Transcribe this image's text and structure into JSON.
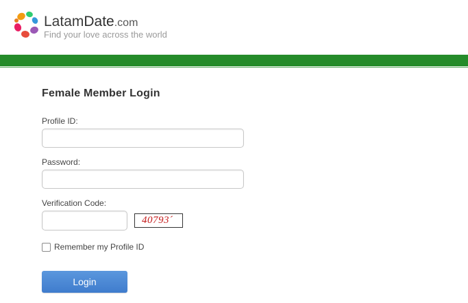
{
  "header": {
    "brand_latam": "Latam",
    "brand_date": "Date",
    "brand_com": ".com",
    "tagline": "Find your love across the world"
  },
  "form": {
    "title": "Female Member Login",
    "profile_label": "Profile ID:",
    "profile_value": "",
    "password_label": "Password:",
    "password_value": "",
    "verify_label": "Verification Code:",
    "verify_value": "",
    "captcha_text": "40793´",
    "remember_label": "Remember my Profile ID",
    "remember_checked": false,
    "login_label": "Login"
  },
  "colors": {
    "green_bar": "#258b2a",
    "login_button": "#4a88d6",
    "captcha_text": "#c41b1b"
  }
}
